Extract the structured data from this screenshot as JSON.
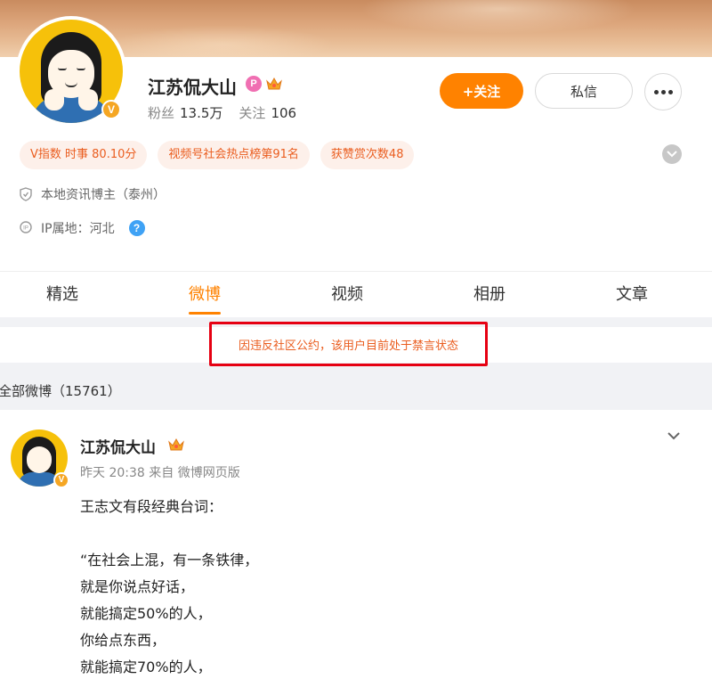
{
  "profile": {
    "name": "江苏侃大山",
    "badge_p": "P",
    "verified_mark": "V",
    "stats": {
      "fans_label": "粉丝",
      "fans_value": "13.5万",
      "follow_label": "关注",
      "follow_value": "106"
    },
    "buttons": {
      "follow": "+关注",
      "message": "私信"
    },
    "tags": [
      "V指数 时事 80.10分",
      "视频号社会热点榜第91名",
      "获赞赏次数48"
    ],
    "info": {
      "local_blogger": "本地资讯博主（泰州）",
      "ip_location": "IP属地：河北",
      "help_glyph": "?"
    }
  },
  "tabs": [
    "精选",
    "微博",
    "视频",
    "相册",
    "文章"
  ],
  "active_tab": "微博",
  "notice": "因违反社区公约，该用户目前处于禁言状态",
  "all_posts_label": "全部微博（15761）",
  "post": {
    "author": "江苏侃大山",
    "time": "昨天 20:38",
    "source": "来自 微博网页版",
    "lines": [
      "王志文有段经典台词：",
      "",
      "“在社会上混，有一条铁律，",
      "就是你说点好话，",
      "就能搞定50%的人，",
      "你给点东西，",
      "就能搞定70%的人，"
    ]
  },
  "colors": {
    "accent": "#ff8200",
    "notice_text": "#ea5d1f",
    "highlight_border": "#e60012",
    "tag_bg": "#fdf0ea",
    "link_blue": "#3fa2f5"
  },
  "icons": {
    "crown": "crown-icon",
    "shield": "shield-icon",
    "ip": "ip-location-icon",
    "more": "more-dots-icon",
    "expand": "chevron-down-icon"
  }
}
